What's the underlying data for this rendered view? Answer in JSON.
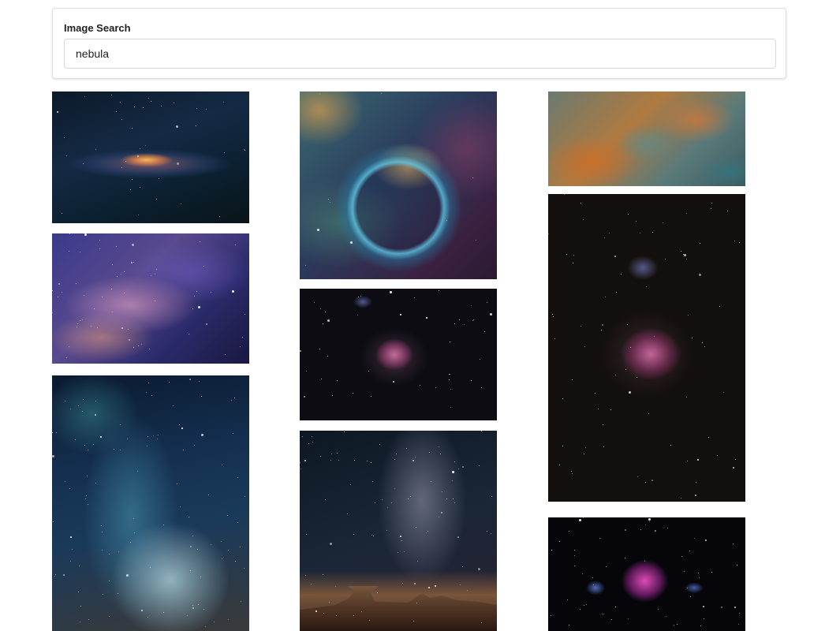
{
  "search": {
    "label": "Image Search",
    "value": "nebula"
  },
  "results": [
    {
      "name": "milky-way-galaxy-core-image"
    },
    {
      "name": "purple-milky-way-image"
    },
    {
      "name": "blue-starfield-milky-way-image"
    },
    {
      "name": "bubble-nebula-image"
    },
    {
      "name": "orion-nebula-image"
    },
    {
      "name": "milky-way-over-rock-formations-image"
    },
    {
      "name": "carina-nebula-pillars-image"
    },
    {
      "name": "orion-nebula-tall-image"
    },
    {
      "name": "orion-nebula-magenta-image"
    }
  ]
}
